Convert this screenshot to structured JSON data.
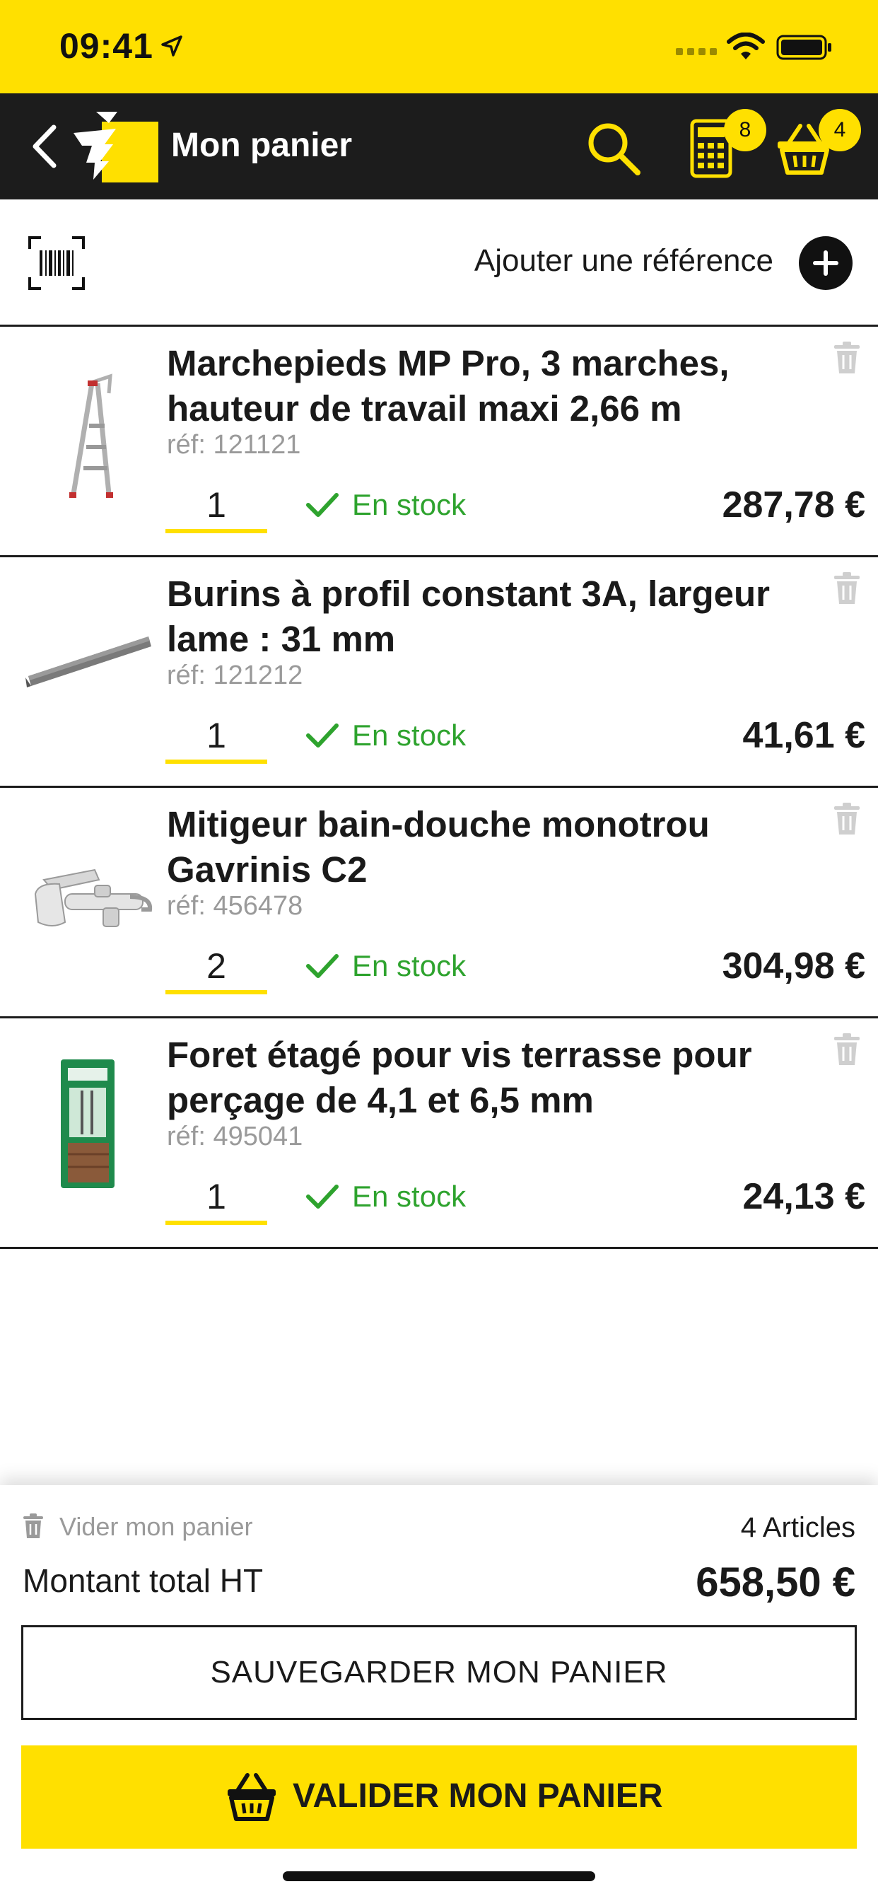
{
  "status_bar": {
    "time": "09:41"
  },
  "nav": {
    "title": "Mon panier",
    "calculator_badge": "8",
    "basket_badge": "4"
  },
  "add_reference": {
    "label": "Ajouter une référence"
  },
  "items": [
    {
      "name": "Marchepieds MP Pro, 3 marches, hauteur de travail maxi 2,66 m",
      "ref": "réf: 121121",
      "qty": "1",
      "stock": "En stock",
      "price": "287,78 €"
    },
    {
      "name": "Burins à profil constant 3A, largeur lame : 31 mm",
      "ref": "réf: 121212",
      "qty": "1",
      "stock": "En stock",
      "price": "41,61 €"
    },
    {
      "name": "Mitigeur bain-douche monotrou Gavrinis C2",
      "ref": "réf: 456478",
      "qty": "2",
      "stock": "En stock",
      "price": "304,98 €"
    },
    {
      "name": "Foret étagé pour vis terrasse pour perçage de 4,1 et 6,5 mm",
      "ref": "réf: 495041",
      "qty": "1",
      "stock": "En stock",
      "price": "24,13 €"
    }
  ],
  "footer": {
    "clear_label": "Vider mon panier",
    "articles_count": "4 Articles",
    "total_label": "Montant total HT",
    "total_value": "658,50 €",
    "save_label": "SAUVEGARDER MON PANIER",
    "validate_label": "VALIDER MON PANIER"
  },
  "colors": {
    "accent": "#ffe000",
    "navbar": "#1c1c1c",
    "stock_green": "#2ea32e",
    "muted": "#9a9a9a"
  }
}
